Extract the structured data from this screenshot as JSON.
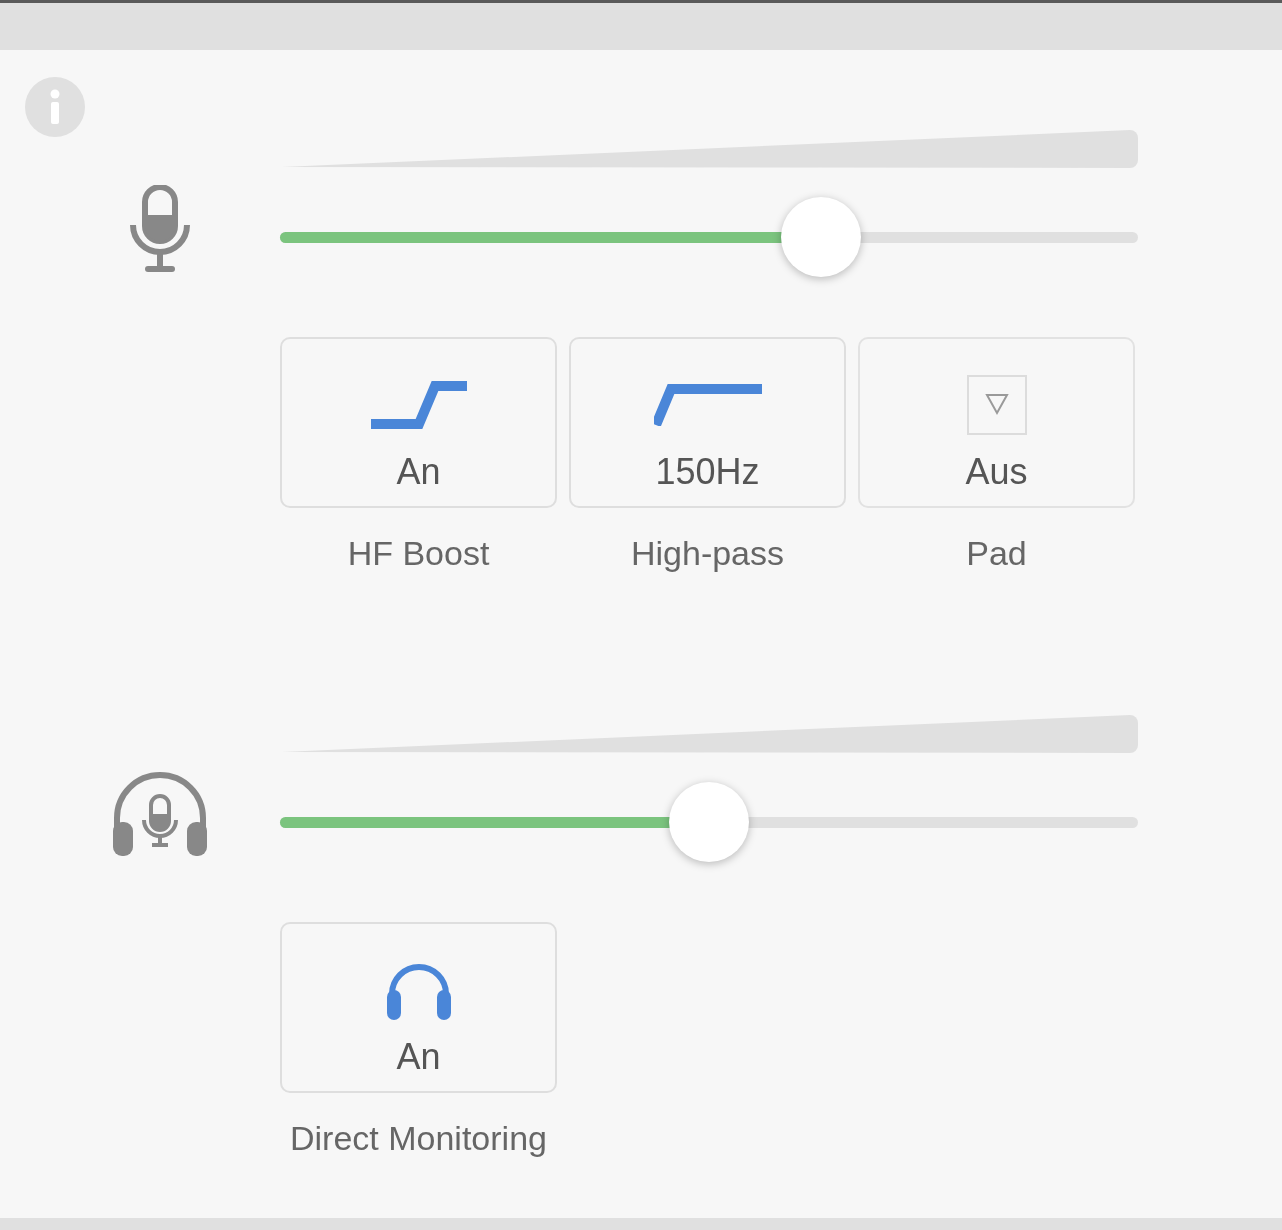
{
  "sections": [
    {
      "kind": "microphone",
      "level": 0.63,
      "buttons": [
        {
          "kind": "hf_boost",
          "value": "An",
          "label": "HF Boost",
          "on": true
        },
        {
          "kind": "high_pass",
          "value": "150Hz",
          "label": "High-pass",
          "on": true
        },
        {
          "kind": "pad",
          "value": "Aus",
          "label": "Pad",
          "on": false
        }
      ]
    },
    {
      "kind": "headset",
      "level": 0.5,
      "buttons": [
        {
          "kind": "monitoring",
          "value": "An",
          "label": "Direct Monitoring",
          "on": true
        }
      ]
    }
  ]
}
